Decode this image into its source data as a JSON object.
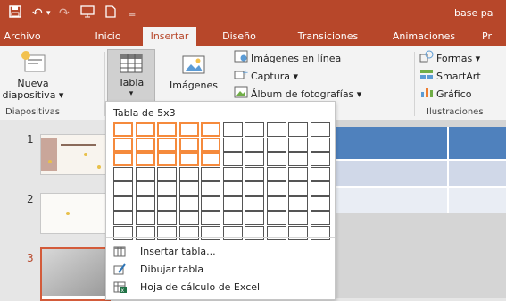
{
  "title_bar": {
    "title": "base pa",
    "quick_access": [
      "save-icon",
      "undo-icon",
      "redo-icon",
      "slideshow-icon",
      "new-icon",
      "customize-icon"
    ]
  },
  "tabs": [
    {
      "label": "Archivo",
      "active": false
    },
    {
      "label": "Inicio",
      "active": false
    },
    {
      "label": "Insertar",
      "active": true
    },
    {
      "label": "Diseño",
      "active": false
    },
    {
      "label": "Transiciones",
      "active": false
    },
    {
      "label": "Animaciones",
      "active": false
    },
    {
      "label": "Pr",
      "active": false
    }
  ],
  "ribbon": {
    "nueva_line1": "Nueva",
    "nueva_line2": "diapositiva ▾",
    "tabla": "Tabla",
    "imagenes": "Imágenes",
    "imagenes_en_linea": "Imágenes en línea",
    "captura": "Captura ▾",
    "album": "Álbum de fotografías ▾",
    "formas": "Formas ▾",
    "smartart": "SmartArt",
    "grafico": "Gráfico",
    "group_diapositivas": "Diapositivas",
    "group_ilustraciones": "Ilustraciones"
  },
  "slides": {
    "numbers": [
      "1",
      "2",
      "3"
    ],
    "selected": "3"
  },
  "dropdown": {
    "title": "Tabla de 5x3",
    "grid_cols": 10,
    "grid_rows": 8,
    "highlight_cols": 5,
    "highlight_rows": 3,
    "items": [
      {
        "label": "Insertar tabla...",
        "icon": "insert-table-icon"
      },
      {
        "label": "Dibujar tabla",
        "icon": "draw-table-icon"
      },
      {
        "label": "Hoja de cálculo de Excel",
        "icon": "excel-icon"
      }
    ]
  },
  "colors": {
    "accent": "#b7472a",
    "highlight": "#f58a3c",
    "table_header": "#4f81bd"
  }
}
